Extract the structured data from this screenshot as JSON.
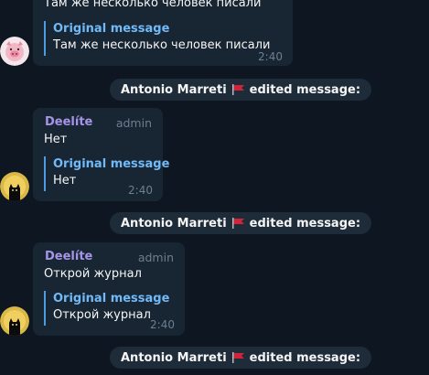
{
  "messages": [
    {
      "text": "Там же несколько человек писали",
      "quote_title": "Original message",
      "quote_text": "Там же несколько человек писали",
      "time": "2:40"
    },
    {
      "author": "Deelíte",
      "role": "admin",
      "text": "Нет",
      "quote_title": "Original message",
      "quote_text": "Нет",
      "time": "2:40"
    },
    {
      "author": "Deelíte",
      "role": "admin",
      "text": "Открой журнал",
      "quote_title": "Original message",
      "quote_text": "Открой журнал",
      "time": "2:40"
    }
  ],
  "services": [
    {
      "name": "Antonio Marreti",
      "action": "edited message:"
    },
    {
      "name": "Antonio Marreti",
      "action": "edited message:"
    },
    {
      "name": "Antonio Marreti",
      "action": "edited message:"
    }
  ],
  "colors": {
    "background": "#0e1621",
    "bubble": "#182533",
    "author": "#a695e7",
    "quote_accent": "#71baf7",
    "flag": "#d0243b"
  },
  "icons": {
    "flag": "red-flag-icon",
    "avatar_pig": "pink-pig-avatar-icon",
    "avatar_cat": "black-cat-moon-avatar-icon"
  }
}
